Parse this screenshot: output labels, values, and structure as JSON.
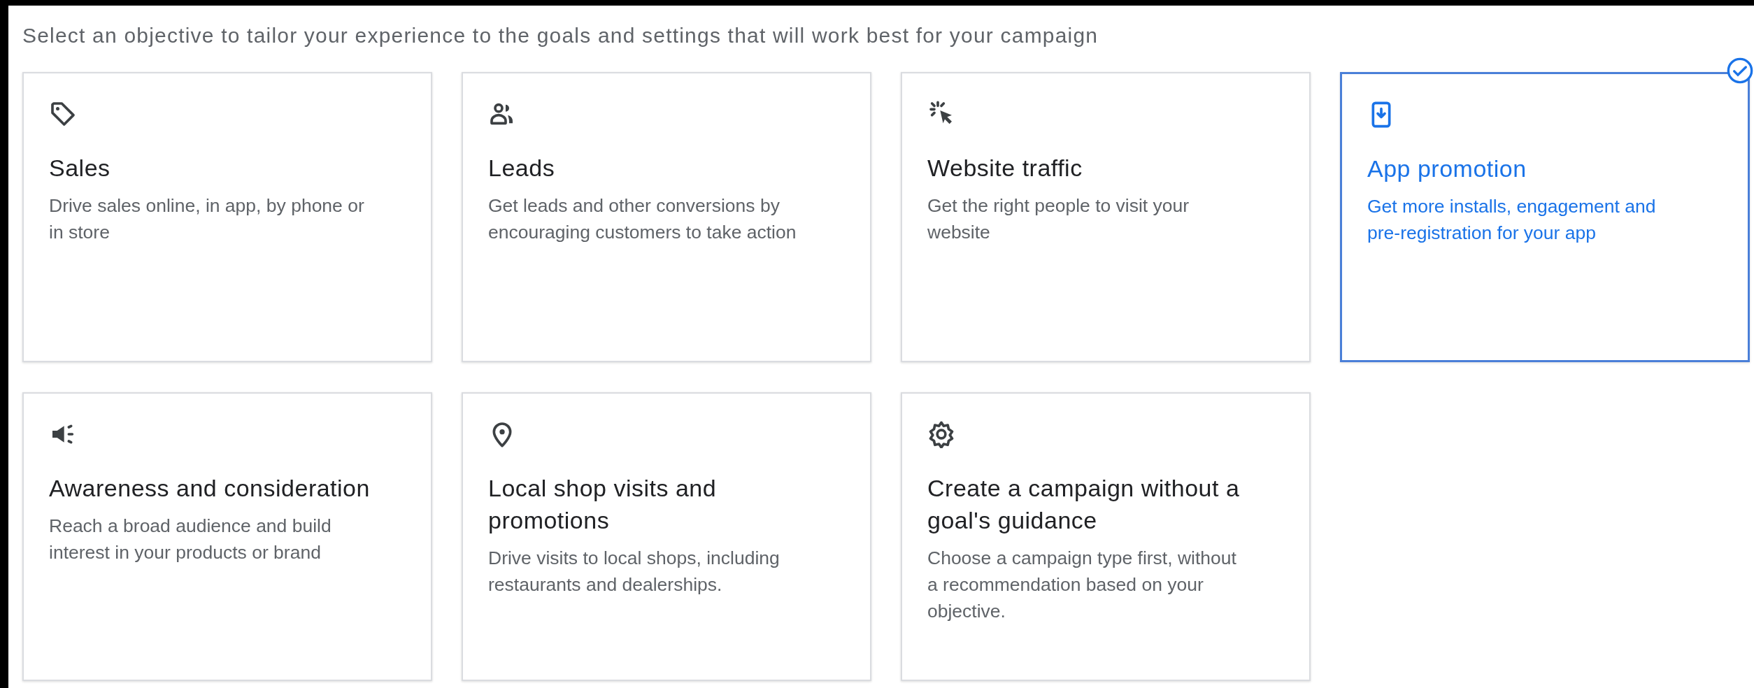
{
  "instruction": "Select an objective to tailor your experience to the goals and settings that will work best for your campaign",
  "objectives": [
    {
      "kind": "sales",
      "title": "Sales",
      "description": "Drive sales online, in app, by phone or in store",
      "selected": false
    },
    {
      "kind": "leads",
      "title": "Leads",
      "description": "Get leads and other conversions by encouraging customers to take action",
      "selected": false
    },
    {
      "kind": "traffic",
      "title": "Website traffic",
      "description": "Get the right people to visit your website",
      "selected": false
    },
    {
      "kind": "app",
      "title": "App promotion",
      "description": "Get more installs, engagement and pre-registration for your app",
      "selected": true
    },
    {
      "kind": "awareness",
      "title": "Awareness and consideration",
      "description": "Reach a broad audience and build interest in your products or brand",
      "selected": false
    },
    {
      "kind": "local",
      "title": "Local shop visits and promotions",
      "description": "Drive visits to local shops, including restaurants and dealerships.",
      "selected": false
    },
    {
      "kind": "none",
      "title": "Create a campaign without a goal's guidance",
      "description": "Choose a campaign type first, without a recommendation based on your objective.",
      "selected": false
    }
  ]
}
